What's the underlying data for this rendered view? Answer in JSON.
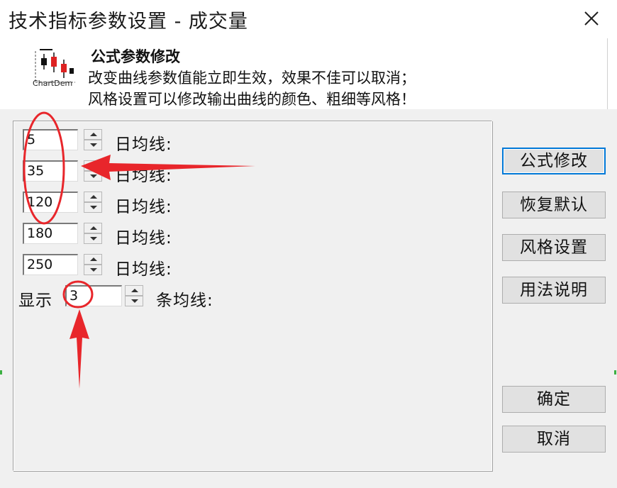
{
  "window": {
    "title": "技术指标参数设置 - 成交量",
    "close_glyph": "✕"
  },
  "header": {
    "logo_caption": "ChartDem",
    "title": "公式参数修改",
    "line1": "改变曲线参数值能立即生效，效果不佳可以取消；",
    "line2": "风格设置可以修改输出曲线的颜色、粗细等风格！"
  },
  "params": [
    {
      "value": "5",
      "label": "日均线:"
    },
    {
      "value": "35",
      "label": "日均线:"
    },
    {
      "value": "120",
      "label": "日均线:"
    },
    {
      "value": "180",
      "label": "日均线:"
    },
    {
      "value": "250",
      "label": "日均线:"
    }
  ],
  "display": {
    "prefix": "显示",
    "value": "3",
    "suffix": "条均线:"
  },
  "buttons": {
    "formula_edit": "公式修改",
    "restore_default": "恢复默认",
    "style_settings": "风格设置",
    "usage_help": "用法说明",
    "ok": "确定",
    "cancel": "取消"
  },
  "colors": {
    "annotation": "#e8262b",
    "default_button_border": "#0078d7",
    "dialog_background": "#f0f0f0"
  }
}
